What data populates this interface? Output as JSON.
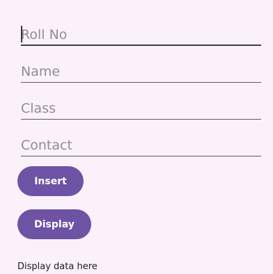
{
  "form": {
    "fields": [
      {
        "id": "roll",
        "placeholder": "Roll No",
        "value": "",
        "focused": true
      },
      {
        "id": "name",
        "placeholder": "Name",
        "value": ""
      },
      {
        "id": "class",
        "placeholder": "Class",
        "value": ""
      },
      {
        "id": "contact",
        "placeholder": "Contact",
        "value": ""
      }
    ]
  },
  "buttons": {
    "insert_label": "Insert",
    "display_label": "Display"
  },
  "output": {
    "text": "Display data here"
  },
  "colors": {
    "background": "#fbf1fb",
    "button": "#6e53a5",
    "button_text": "#ffffff",
    "placeholder": "#8f8d93",
    "underline": "#5d5a60"
  }
}
